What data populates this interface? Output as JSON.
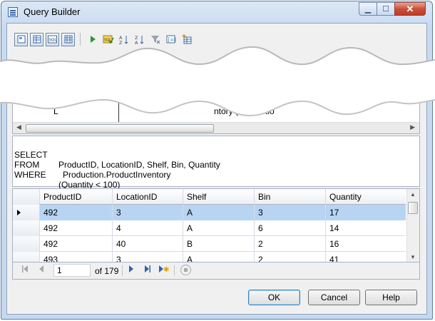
{
  "window": {
    "title": "Query Builder",
    "icon": "query-builder-icon"
  },
  "toolbar": {
    "buttons": [
      "diagram-pane-toggle-icon",
      "grid-pane-toggle-icon",
      "sql-pane-toggle-icon",
      "results-pane-toggle-icon",
      "run-icon",
      "verify-sql-icon",
      "sort-ascending-icon",
      "sort-descending-icon",
      "remove-filter-icon",
      "group-by-icon",
      "add-table-icon"
    ]
  },
  "diagram_fragment": {
    "left_text": "L",
    "right_text": "ntory (Productio"
  },
  "sql": {
    "lines": [
      {
        "keyword": "SELECT",
        "body": "ProductID, LocationID, Shelf, Bin, Quantity"
      },
      {
        "keyword": "FROM",
        "body": "Production.ProductInventory"
      },
      {
        "keyword": "WHERE",
        "body": "(Quantity < 100)"
      }
    ]
  },
  "results": {
    "columns": [
      "ProductID",
      "LocationID",
      "Shelf",
      "Bin",
      "Quantity"
    ],
    "rows": [
      [
        "492",
        "3",
        "A",
        "3",
        "17"
      ],
      [
        "492",
        "4",
        "A",
        "6",
        "14"
      ],
      [
        "492",
        "40",
        "B",
        "2",
        "16"
      ],
      [
        "493",
        "3",
        "A",
        "2",
        "41"
      ]
    ],
    "selected_row": 0
  },
  "navigator": {
    "current": "1",
    "of_label": "of 179"
  },
  "buttons": {
    "ok": "OK",
    "cancel": "Cancel",
    "help": "Help"
  },
  "colors": {
    "selection": "#b7d5f3",
    "accent": "#2f62b0"
  }
}
